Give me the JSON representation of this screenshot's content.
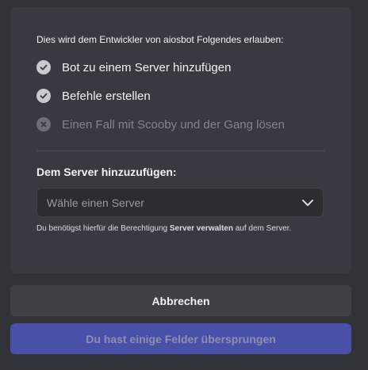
{
  "oauth": {
    "intro": "Dies wird dem Entwickler von aiosbot Folgendes erlauben:",
    "permissions": [
      {
        "label": "Bot zu einem Server hinzufügen",
        "icon": "check-icon",
        "granted": true
      },
      {
        "label": "Befehle erstellen",
        "icon": "check-icon",
        "granted": true
      },
      {
        "label": "Einen Fall mit Scooby und der Gang lösen",
        "icon": "cross-icon",
        "granted": false
      }
    ],
    "server_section_title": "Dem Server hinzuzufügen:",
    "server_select_placeholder": "Wähle einen Server",
    "help_prefix": "Du benötigst hierfür die Berechtigung ",
    "help_bold": "Server verwalten",
    "help_suffix": " auf dem Server."
  },
  "buttons": {
    "cancel_label": "Abbrechen",
    "primary_label": "Du hast einige Felder übersprungen"
  },
  "colors": {
    "background": "#313338",
    "card": "#393a41",
    "brand": "#5865f2"
  }
}
